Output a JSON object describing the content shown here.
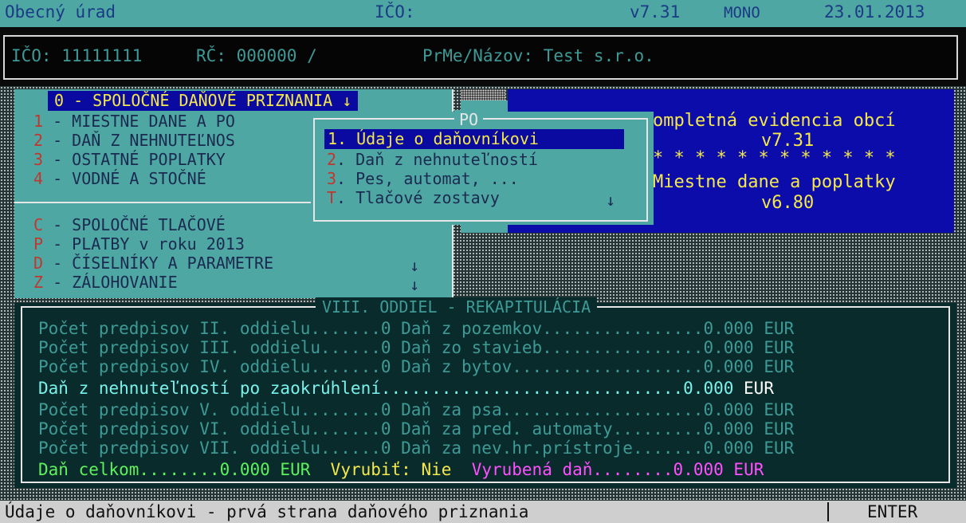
{
  "colors": {
    "teal": "#4fa7a3",
    "navy": "#1b3a85",
    "blue_panel": "#0c0cab",
    "yellow": "#f5e84b",
    "magenta": "#ff4fff",
    "green": "#5df25d"
  },
  "titlebar": {
    "app": "Obecný úrad",
    "ico_label": "IČO:",
    "version": "v7.31",
    "mode": "MONO",
    "date": "23.01.2013"
  },
  "info": {
    "ico": "IČO: 11111111",
    "rc": "RČ: 000000 /",
    "name": "PrMe/Názov: Test s.r.o."
  },
  "menu": {
    "items": [
      {
        "key": "0",
        "text": " - SPOLOČNÉ DAŇOVÉ PRIZNANIA ↓"
      },
      {
        "key": "1",
        "text": " - MIESTNE DANE A PO"
      },
      {
        "key": "2",
        "text": " - DAŇ Z NEHNUTEĽNOS"
      },
      {
        "key": "3",
        "text": " - OSTATNÉ POPLATKY"
      },
      {
        "key": "4",
        "text": " - VODNÉ A STOČNÉ"
      },
      {
        "key": "C",
        "text": " - SPOLOČNÉ TLAČOVÉ"
      },
      {
        "key": "P",
        "text": " - PLATBY v roku 2013"
      },
      {
        "key": "D",
        "text": " - ČÍSELNÍKY A PARAMETRE"
      },
      {
        "key": "Z",
        "text": " - ZÁLOHOVANIE"
      }
    ],
    "arrow": "↓"
  },
  "blue_panel": {
    "line1": "ompletná evidencia obcí",
    "line2": "v7.31",
    "line3": "* * * * * * * * * * * *",
    "line4": "Miestne dane a poplatky",
    "line5": "v6.80"
  },
  "submenu": {
    "title": "PO",
    "items": [
      {
        "key": "1",
        "text": ". Údaje o daňovníkovi"
      },
      {
        "key": "2",
        "text": ". Daň z nehnuteľností"
      },
      {
        "key": "3",
        "text": ". Pes, automat, ..."
      },
      {
        "key": "T",
        "text": ". Tlačové zostavy"
      }
    ],
    "arrow": "↓"
  },
  "recap": {
    "title": "VIII. ODDIEL - REKAPITULÁCIA",
    "lines": [
      {
        "text": "Počet predpisov II. oddielu.......0 Daň z pozemkov................0.000",
        "eur": "EUR"
      },
      {
        "text": "Počet predpisov III. oddielu......0 Daň zo stavieb................0.000",
        "eur": "EUR"
      },
      {
        "text": "Počet predpisov IV. oddielu.......0 Daň z bytov...................0.000",
        "eur": "EUR"
      },
      {
        "text": "Daň z nehnuteľností po zaokrúhlení..............................0.000",
        "eur": "EUR"
      },
      {
        "text": "Počet predpisov V. oddielu........0 Daň za psa....................0.000",
        "eur": "EUR"
      },
      {
        "text": "Počet predpisov VI. oddielu.......0 Daň za pred. automaty.........0.000",
        "eur": "EUR"
      },
      {
        "text": "Počet predpisov VII. oddielu......0 Daň za nev.hr.prístroje.......0.000",
        "eur": "EUR"
      }
    ],
    "total": {
      "celkom": "Daň celkom........0.000 EUR",
      "vyrubit": "Vyrubiť: Nie",
      "vyrubena": "Vyrubená daň........0.000",
      "eur": "EUR"
    }
  },
  "status": {
    "help": "Údaje o daňovníkovi - prvá strana daňového priznania",
    "key": "ENTER"
  }
}
